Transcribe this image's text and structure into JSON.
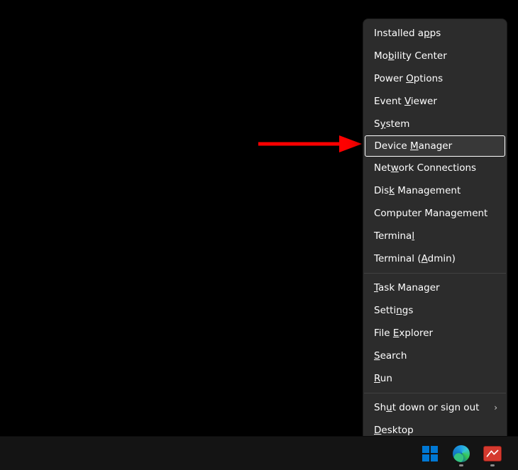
{
  "menu": {
    "group1": [
      {
        "pre": "Installed a",
        "u": "p",
        "post": "ps"
      },
      {
        "pre": "Mo",
        "u": "b",
        "post": "ility Center"
      },
      {
        "pre": "Power ",
        "u": "O",
        "post": "ptions"
      },
      {
        "pre": "Event ",
        "u": "V",
        "post": "iewer"
      },
      {
        "pre": "S",
        "u": "y",
        "post": "stem"
      },
      {
        "pre": "Device ",
        "u": "M",
        "post": "anager",
        "highlight": true
      },
      {
        "pre": "Net",
        "u": "w",
        "post": "ork Connections"
      },
      {
        "pre": "Dis",
        "u": "k",
        "post": " Management"
      },
      {
        "pre": "Computer Mana",
        "u": "g",
        "post": "ement"
      },
      {
        "pre": "Termina",
        "u": "l",
        "post": ""
      },
      {
        "pre": "Terminal (",
        "u": "A",
        "post": "dmin)"
      }
    ],
    "group2": [
      {
        "pre": "",
        "u": "T",
        "post": "ask Manager"
      },
      {
        "pre": "Setti",
        "u": "n",
        "post": "gs"
      },
      {
        "pre": "File ",
        "u": "E",
        "post": "xplorer"
      },
      {
        "pre": "",
        "u": "S",
        "post": "earch"
      },
      {
        "pre": "",
        "u": "R",
        "post": "un"
      }
    ],
    "group3": [
      {
        "pre": "Sh",
        "u": "u",
        "post": "t down or sign out",
        "submenu": true
      },
      {
        "pre": "",
        "u": "D",
        "post": "esktop"
      }
    ]
  },
  "annotation": {
    "target": "Device Manager",
    "color": "#ff0000"
  },
  "taskbar": {
    "items": [
      {
        "id": "start",
        "name": "start-button",
        "running": false
      },
      {
        "id": "edge",
        "name": "edge-icon",
        "running": true
      },
      {
        "id": "app3",
        "name": "red-app-icon",
        "running": true
      }
    ]
  }
}
